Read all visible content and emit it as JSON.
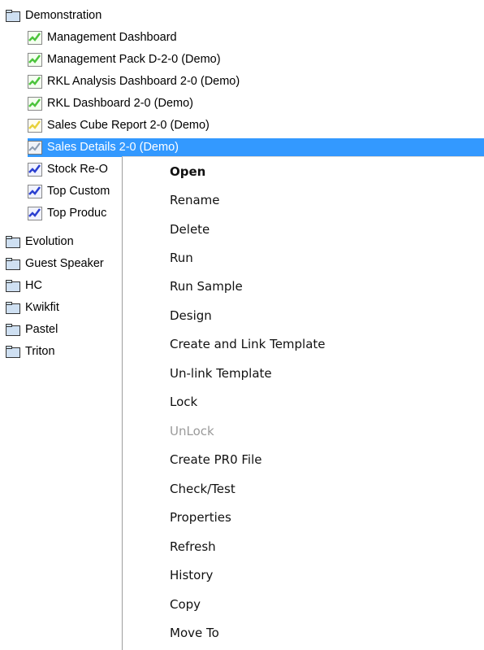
{
  "tree": {
    "root_folder": "Demonstration",
    "reports": [
      {
        "label": "Management Dashboard",
        "icon": "green-chart-icon"
      },
      {
        "label": "Management Pack D-2-0 (Demo)",
        "icon": "green-chart-icon"
      },
      {
        "label": "RKL Analysis Dashboard 2-0 (Demo)",
        "icon": "green-chart-icon"
      },
      {
        "label": "RKL Dashboard 2-0 (Demo)",
        "icon": "green-chart-icon"
      },
      {
        "label": "Sales Cube Report 2-0 (Demo)",
        "icon": "yellow-chart-icon"
      },
      {
        "label": "Sales Details 2-0 (Demo)",
        "icon": "grey-chart-icon",
        "selected": true
      },
      {
        "label": "Stock Re-O",
        "icon": "blue-chart-icon"
      },
      {
        "label": "Top Custom",
        "icon": "blue-chart-icon"
      },
      {
        "label": "Top Produc",
        "icon": "blue-chart-icon"
      }
    ],
    "folders": [
      "Evolution",
      "Guest Speaker",
      "HC",
      "Kwikfit",
      "Pastel",
      "Triton"
    ]
  },
  "context_menu": {
    "items": [
      {
        "label": "Open",
        "bold": true
      },
      {
        "label": "Rename"
      },
      {
        "label": "Delete"
      },
      {
        "label": "Run"
      },
      {
        "label": "Run Sample"
      },
      {
        "label": "Design"
      },
      {
        "label": "Create and Link Template"
      },
      {
        "label": "Un-link Template"
      },
      {
        "label": "Lock"
      },
      {
        "label": "UnLock",
        "disabled": true
      },
      {
        "label": "Create PR0 File"
      },
      {
        "label": "Check/Test"
      },
      {
        "label": "Properties"
      },
      {
        "label": "Refresh"
      },
      {
        "label": "History"
      },
      {
        "label": "Copy"
      },
      {
        "label": "Move To"
      }
    ]
  },
  "colors": {
    "selection": "#3399ff",
    "folder": "#cfe0f2",
    "chart_green": "#4cc43c",
    "chart_blue": "#2a3fd0",
    "chart_yellow": "#e8d23a",
    "disabled_text": "#9a9a9a"
  }
}
